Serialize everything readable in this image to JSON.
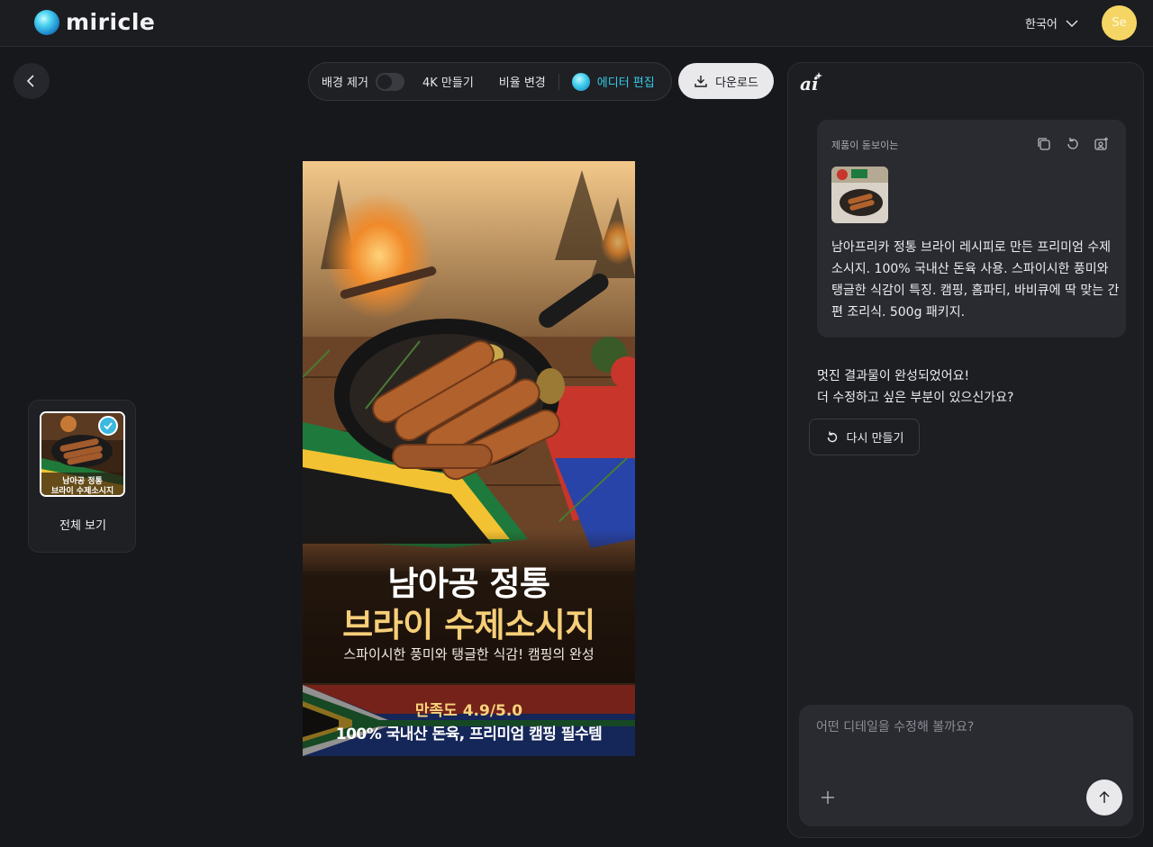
{
  "header": {
    "logo_text": "miricle",
    "language": "한국어",
    "avatar_initials": "Se"
  },
  "toolbar": {
    "remove_bg_label": "배경 제거",
    "remove_bg_enabled": false,
    "upscale_label": "4K 만들기",
    "ratio_label": "비율 변경",
    "editor_label": "에디터 편집",
    "download_label": "다운로드"
  },
  "thumbnail": {
    "label": "전체 보기",
    "selected": true,
    "caption_line1": "남아공 정통",
    "caption_line2": "브라이 수제소시지"
  },
  "main_image": {
    "headline_line1": "남아공 정통",
    "headline_line2": "브라이 수제소시지",
    "subline": "스파이시한 풍미와 탱글한 식감! 캠핑의 완성",
    "rating": "만족도 4.9/5.0",
    "tagline": "100% 국내산 돈육, 프리미엄 캠핑 필수템"
  },
  "chat": {
    "prompt_type": "제품이 돋보이는",
    "prompt_text": "남아프리카 정통 브라이 레시피로 만든 프리미엄 수제소시지. 100% 국내산 돈육 사용. 스파이시한 풍미와 탱글한 식감이 특징. 캠핑, 홈파티, 바비큐에 딱 맞는 간편 조리식. 500g 패키지.",
    "reply_line1": "멋진 결과물이 완성되었어요!",
    "reply_line2": "더 수정하고 싶은 부분이 있으신가요?",
    "regenerate_label": "다시 만들기",
    "input_placeholder": "어떤 디테일을 수정해 볼까요?"
  },
  "colors": {
    "accent": "#35c9e8",
    "avatar": "#f5d665",
    "headline_gold": "#f6cf79",
    "background": "#17181c"
  },
  "icons": {
    "back": "chevron-left-icon",
    "language": "chevron-down-icon",
    "download": "download-icon",
    "copy": "copy-icon",
    "retry": "refresh-icon",
    "image_edit": "image-person-icon",
    "send": "arrow-up-icon",
    "attach": "plus-icon"
  }
}
